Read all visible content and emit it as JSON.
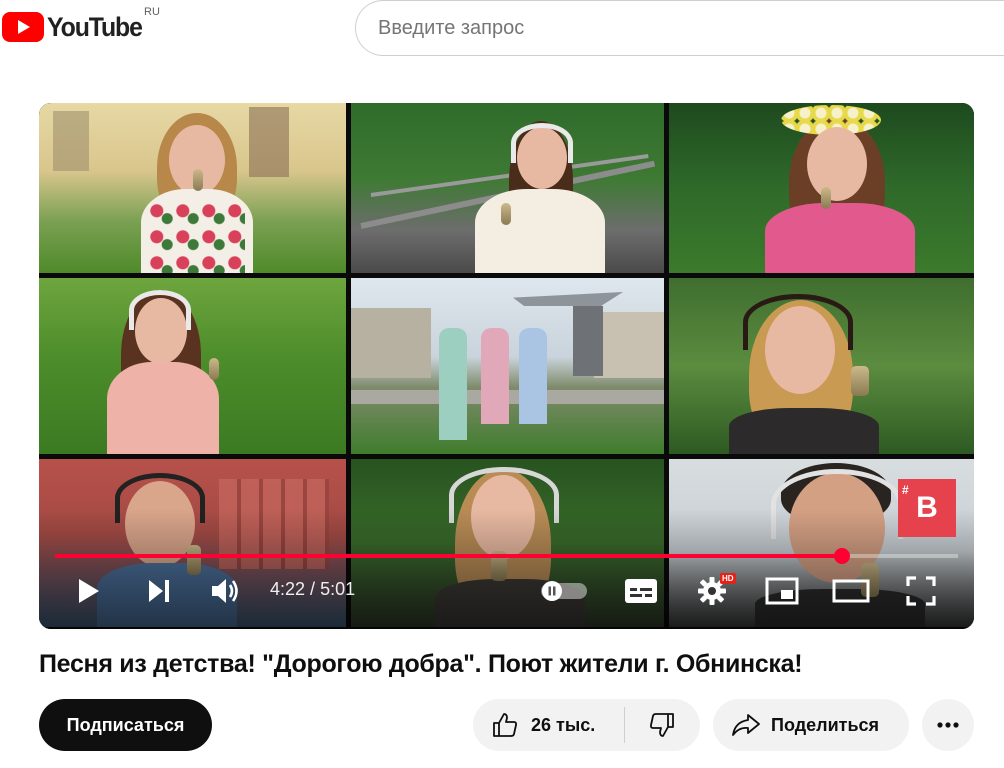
{
  "header": {
    "logo_text": "YouTube",
    "region": "RU",
    "search_placeholder": "Введите запрос"
  },
  "player": {
    "time_current": "4:22",
    "time_separator": " / ",
    "time_total": "5:01",
    "progress_fraction": 0.871,
    "hd_badge": "HD",
    "channel_badge_hash": "#",
    "channel_badge_letter": "B"
  },
  "video": {
    "title": "Песня из детства! \"Дорогою добра\". Поют жители г. Обнинска!"
  },
  "actions": {
    "subscribe_label": "Подписаться",
    "like_count": "26 тыс.",
    "share_label": "Поделиться"
  },
  "colors": {
    "brand_red": "#ff0000",
    "progress_red": "#ff0033",
    "subscribe_bg": "#0f0f0f",
    "pill_bg": "#f2f2f2"
  },
  "icons": [
    "youtube-logo-icon",
    "play-icon",
    "next-icon",
    "volume-icon",
    "autoplay-toggle-icon",
    "subtitles-icon",
    "settings-icon",
    "miniplayer-icon",
    "theater-icon",
    "fullscreen-icon",
    "like-icon",
    "dislike-icon",
    "share-icon",
    "more-icon"
  ]
}
